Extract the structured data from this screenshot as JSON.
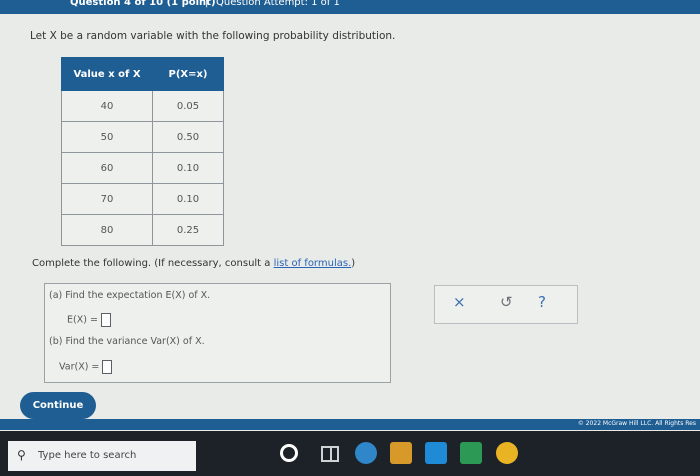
{
  "header": {
    "question": "Question 4 of 10 (1 point)",
    "separator": "|",
    "attempt": "Question Attempt: 1 of 1"
  },
  "intro": "Let X be a random variable with the following probability distribution.",
  "table": {
    "headers": [
      "Value x of X",
      "P(X=x)"
    ],
    "rows": [
      [
        "40",
        "0.05"
      ],
      [
        "50",
        "0.50"
      ],
      [
        "60",
        "0.10"
      ],
      [
        "70",
        "0.10"
      ],
      [
        "80",
        "0.25"
      ]
    ]
  },
  "instructions": {
    "text": "Complete the following. (If necessary, consult a",
    "link": "list of formulas.",
    "end": ")"
  },
  "parts": {
    "a_prompt": "(a) Find the expectation E(X) of X.",
    "a_label": "E(X) =",
    "b_prompt": "(b) Find the variance Var(X) of X.",
    "b_label": "Var(X) ="
  },
  "actions": {
    "clear_icon": "×",
    "undo_icon": "↺",
    "help_icon": "?"
  },
  "continue_label": "Continue",
  "footer": "© 2022 McGraw Hill LLC. All Rights Res",
  "taskbar": {
    "search_placeholder": "Type here to search",
    "icon_colors": [
      "#ffffff",
      "#cfd3d6",
      "#2f86c9",
      "#d79a2a",
      "#1f8bd6",
      "#2c9a55",
      "#e8b423"
    ]
  }
}
